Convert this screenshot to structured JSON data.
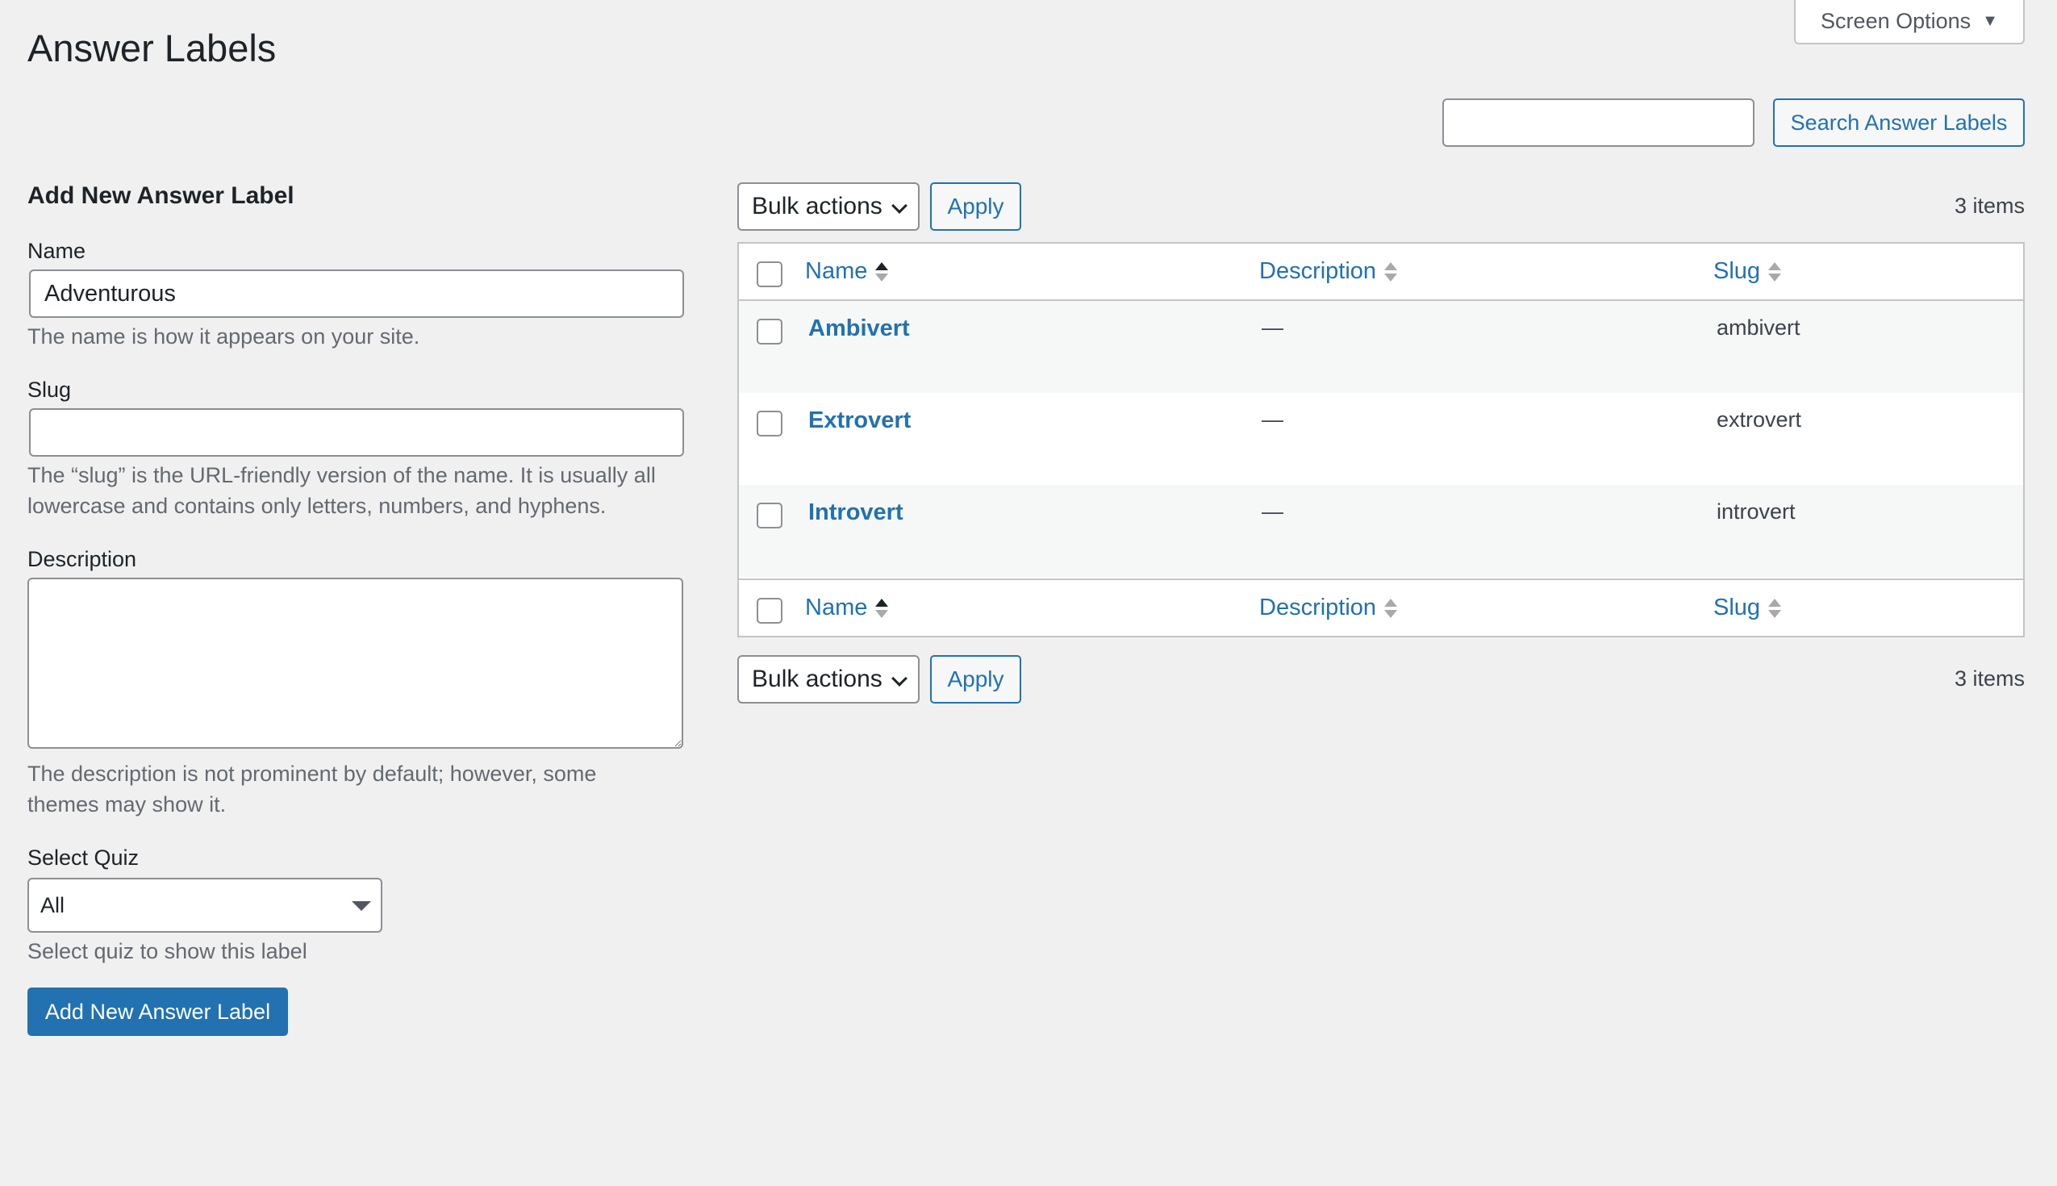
{
  "header": {
    "screen_options": "Screen Options",
    "title": "Answer Labels"
  },
  "search": {
    "value": "",
    "button": "Search Answer Labels"
  },
  "form": {
    "heading": "Add New Answer Label",
    "name_label": "Name",
    "name_value": "Adventurous",
    "name_help": "The name is how it appears on your site.",
    "slug_label": "Slug",
    "slug_value": "",
    "slug_help_1": "The “slug” is the URL-friendly version of the name. It is usually all",
    "slug_help_2": "lowercase and contains only letters, numbers, and hyphens.",
    "description_label": "Description",
    "description_help_1": "The description is not prominent by default; however, some",
    "description_help_2": "themes may show it.",
    "quiz_label": "Select Quiz",
    "quiz_value": "All",
    "quiz_help": "Select quiz to show this label",
    "submit": "Add New Answer Label"
  },
  "bulk": {
    "label": "Bulk actions",
    "apply": "Apply",
    "count": "3 items"
  },
  "table": {
    "columns": {
      "name": "Name",
      "description": "Description",
      "slug": "Slug"
    },
    "rows": [
      {
        "name": "Ambivert",
        "description": "—",
        "slug": "ambivert"
      },
      {
        "name": "Extrovert",
        "description": "—",
        "slug": "extrovert"
      },
      {
        "name": "Introvert",
        "description": "—",
        "slug": "introvert"
      }
    ]
  },
  "colors": {
    "accent": "#2271b1",
    "background": "#f0f0f1",
    "row_alt": "#f6f7f7"
  }
}
